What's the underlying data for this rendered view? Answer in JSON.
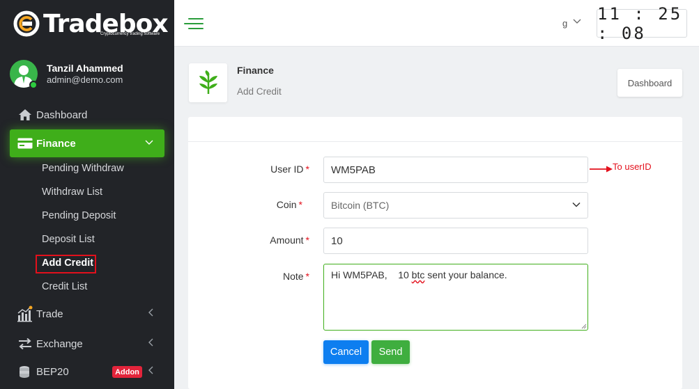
{
  "brand": {
    "name_part1": "Trade",
    "name_part2": "box",
    "tagline": "Cryptocurrency trading software"
  },
  "user": {
    "name": "Tanzil Ahammed",
    "email": "admin@demo.com"
  },
  "sidebar": {
    "items": [
      {
        "label": "Dashboard",
        "icon": "home-icon"
      },
      {
        "label": "Finance",
        "icon": "card-icon",
        "active": true
      },
      {
        "label": "Trade",
        "icon": "trade-chart-icon"
      },
      {
        "label": "Exchange",
        "icon": "exchange-arrows-icon"
      },
      {
        "label": "BEP20",
        "icon": "coin-stack-icon",
        "badge": "Addon"
      }
    ],
    "finance_subitems": [
      "Pending Withdraw",
      "Withdraw List",
      "Pending Deposit",
      "Deposit List",
      "Add Credit",
      "Credit List"
    ]
  },
  "topbar": {
    "language": "g",
    "clock": "11:25:08"
  },
  "page_header": {
    "title": "Finance",
    "subtitle": "Add Credit",
    "dashboard_button": "Dashboard",
    "icon": "leaf-icon"
  },
  "form": {
    "user_id": {
      "label": "User ID",
      "value": "WM5PAB"
    },
    "coin": {
      "label": "Coin",
      "value": "Bitcoin (BTC)"
    },
    "amount": {
      "label": "Amount",
      "value": "10"
    },
    "note": {
      "label": "Note",
      "value_part1": "Hi WM5PAB,    10 ",
      "value_misspelled": "btc",
      "value_part2": " sent your balance."
    },
    "cancel_label": "Cancel",
    "send_label": "Send",
    "required_mark": "*"
  },
  "annotation": {
    "text": "To userID",
    "color": "#e3101c"
  },
  "colors": {
    "accent_green": "#3fae1a",
    "sidebar_bg": "#222428",
    "cancel_blue": "#0d7ef0",
    "send_green": "#3fae3f",
    "badge_red": "#e3243b"
  }
}
